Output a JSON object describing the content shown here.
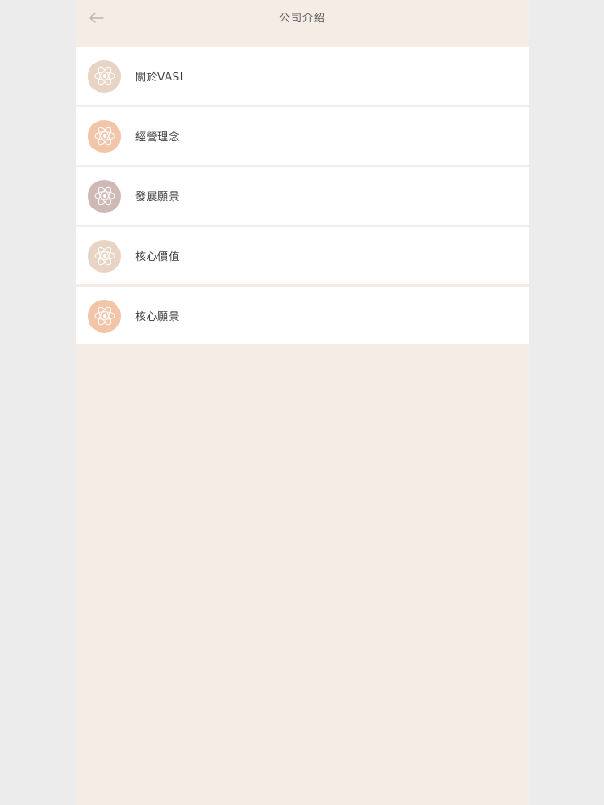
{
  "header": {
    "title": "公司介紹",
    "back_icon": "arrow-left-icon"
  },
  "items": [
    {
      "label": "關於VASI",
      "icon": "atom-icon",
      "color": "#e8d4c4"
    },
    {
      "label": "經營理念",
      "icon": "atom-icon",
      "color": "#f3c5a8"
    },
    {
      "label": "發展願景",
      "icon": "atom-icon",
      "color": "#cfb9b6"
    },
    {
      "label": "核心價值",
      "icon": "atom-icon",
      "color": "#e8d4c4"
    },
    {
      "label": "核心願景",
      "icon": "atom-icon",
      "color": "#f3c5a8"
    }
  ],
  "colors": {
    "background": "#f5ece6",
    "side": "#ececec",
    "row": "#ffffff"
  }
}
